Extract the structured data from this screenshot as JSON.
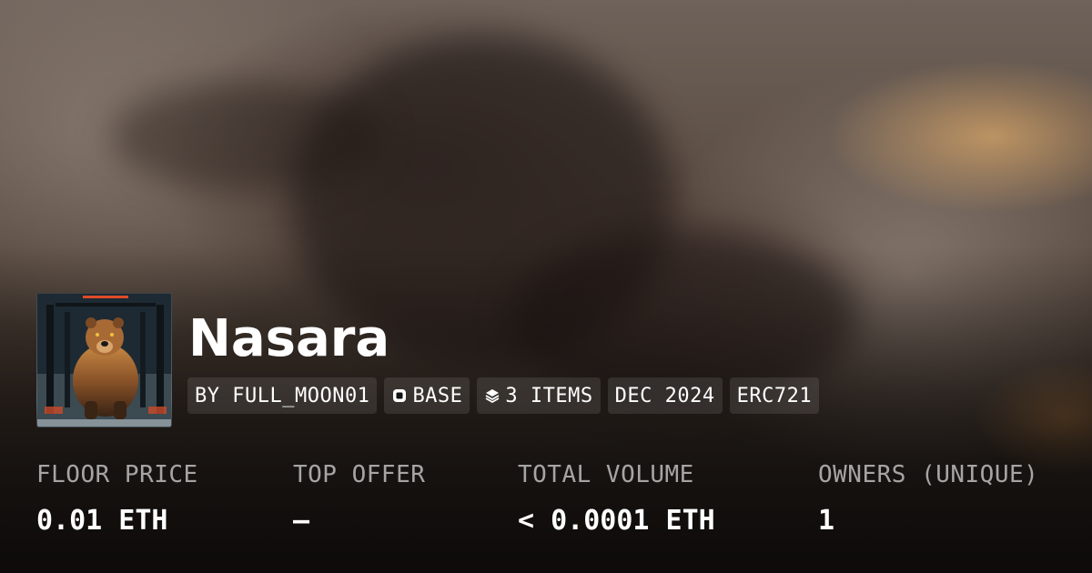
{
  "collection": {
    "name": "Nasara"
  },
  "badges": {
    "creator": "BY FULL_MOON01",
    "chain": "BASE",
    "items": "3 ITEMS",
    "date": "DEC 2024",
    "standard": "ERC721"
  },
  "icons": {
    "chain": "base-chain-icon",
    "items": "layers-icon"
  },
  "stats": {
    "floor_price": {
      "label": "FLOOR PRICE",
      "value": "0.01 ETH"
    },
    "top_offer": {
      "label": "TOP OFFER",
      "value": "–"
    },
    "total_volume": {
      "label": "TOTAL VOLUME",
      "value": "< 0.0001 ETH"
    },
    "owners": {
      "label": "OWNERS (UNIQUE)",
      "value": "1"
    }
  },
  "colors": {
    "text": "#ffffff",
    "label": "#9e9994",
    "badge_bg": "rgba(255,255,255,0.10)"
  }
}
